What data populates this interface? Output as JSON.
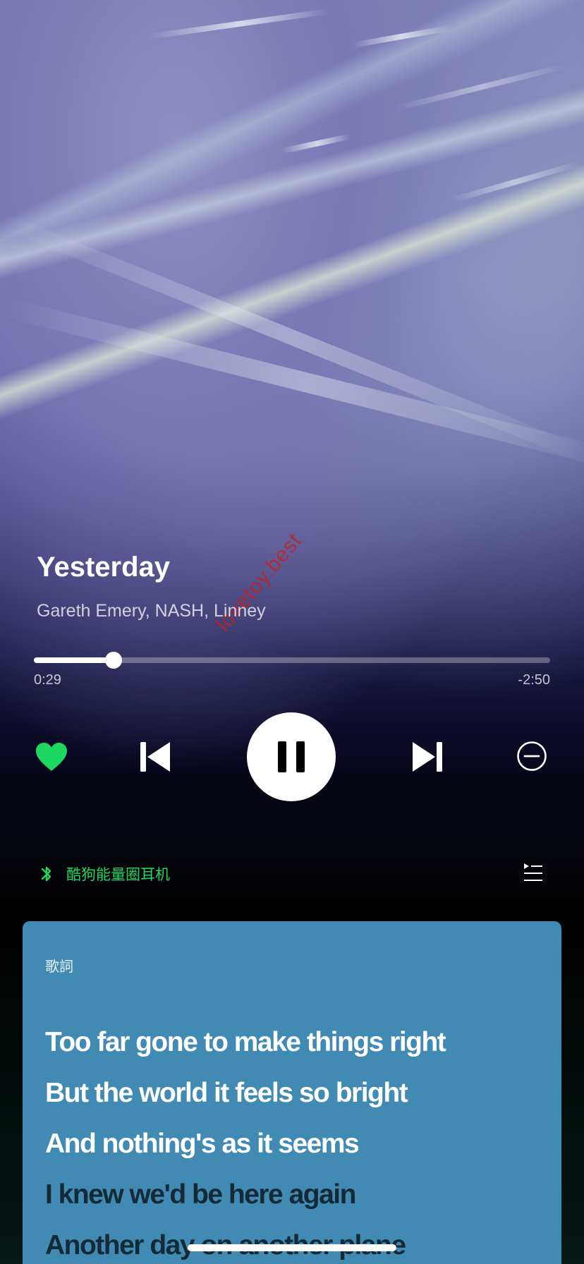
{
  "track": {
    "title": "Yesterday",
    "artists": "Gareth Emery, NASH, Linney"
  },
  "playback": {
    "elapsed": "0:29",
    "remaining": "-2:50",
    "progress_fraction": 0.155,
    "state": "playing"
  },
  "controls": {
    "like": "heart-icon",
    "previous": "skip-previous-icon",
    "play_pause": "pause-icon",
    "next": "skip-next-icon",
    "remove": "minus-circle-icon"
  },
  "device": {
    "icon": "bluetooth-icon",
    "name": "酷狗能量圈耳机"
  },
  "queue": {
    "icon": "queue-icon"
  },
  "watermark": "lovetoy.best",
  "lyrics": {
    "header": "歌詞",
    "lines": [
      {
        "text": "Too far gone to make things right",
        "state": "sung"
      },
      {
        "text": "But the world it feels so bright",
        "state": "sung"
      },
      {
        "text": "And nothing's as it seems",
        "state": "sung"
      },
      {
        "text": "I knew we'd be here again",
        "state": "upcoming"
      },
      {
        "text": "Another day on another plane",
        "state": "upcoming"
      }
    ]
  },
  "colors": {
    "accent_green": "#1ed760",
    "lyrics_card": "#418ab4",
    "lyric_sung": "#ffffff",
    "lyric_upcoming": "#142a36"
  }
}
